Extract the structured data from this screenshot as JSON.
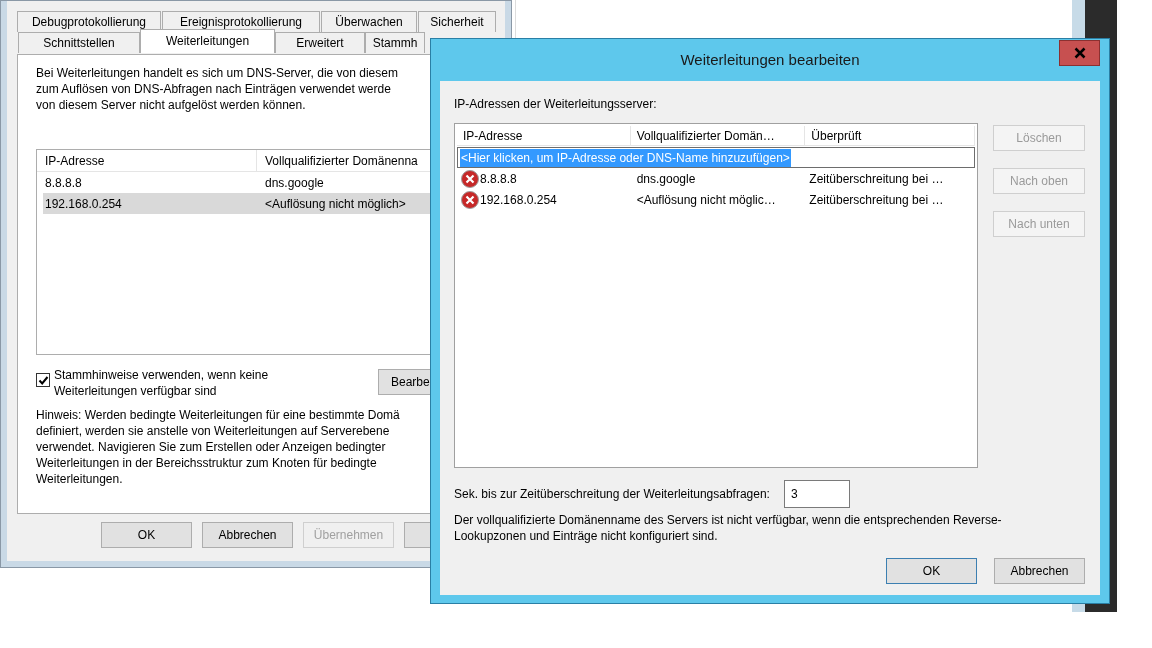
{
  "properties_window": {
    "tabs_row_1": [
      {
        "label": "Debugprotokollierung",
        "selected": false
      },
      {
        "label": "Ereignisprotokollierung",
        "selected": false
      },
      {
        "label": "Überwachen",
        "selected": false
      },
      {
        "label": "Sicherheit",
        "selected": false
      }
    ],
    "tabs_row_2": [
      {
        "label": "Schnittstellen",
        "selected": false
      },
      {
        "label": "Weiterleitungen",
        "selected": true
      },
      {
        "label": "Erweitert",
        "selected": false
      },
      {
        "label": "Stammh",
        "selected": false
      }
    ],
    "description": "Bei Weiterleitungen handelt es sich um DNS-Server, die von diesem\nzum Auflösen von DNS-Abfragen nach Einträgen verwendet werde\nvon diesem Server nicht aufgelöst werden können.",
    "table": {
      "columns": [
        "IP-Adresse",
        "Vollqualifizierter Domänenna"
      ],
      "rows": [
        {
          "cells": [
            "8.8.8.8",
            "dns.google"
          ],
          "selected": false
        },
        {
          "cells": [
            "192.168.0.254",
            "<Auflösung nicht möglich>"
          ],
          "selected": true
        }
      ]
    },
    "root_hints": {
      "label": "Stammhinweise verwenden, wenn keine\nWeiterleitungen verfügbar sind",
      "checked": true
    },
    "edit_button": "Bearbe",
    "note": "Hinweis: Werden bedingte Weiterleitungen für eine bestimmte Domä\ndefiniert, werden sie anstelle von Weiterleitungen auf Serverebene\nverwendet. Navigieren Sie zum Erstellen oder Anzeigen bedingter\nWeiterleitungen in der Bereichsstruktur zum Knoten für bedingte\nWeiterleitungen.",
    "buttons": [
      {
        "label": "OK",
        "disabled": false
      },
      {
        "label": "Abbrechen",
        "disabled": false
      },
      {
        "label": "Übernehmen",
        "disabled": true
      }
    ]
  },
  "dialog": {
    "title": "Weiterleitungen bearbeiten",
    "list_label": "IP-Adressen der Weiterleitungsserver:",
    "columns": [
      "IP-Adresse",
      "Vollqualifizierter Domän…",
      "Überprüft"
    ],
    "add_row": "<Hier klicken, um IP-Adresse oder DNS-Name hinzuzufügen>",
    "rows": [
      {
        "cells": [
          "8.8.8.8",
          "dns.google",
          "Zeitüberschreitung bei …"
        ],
        "kind": "error"
      },
      {
        "cells": [
          "192.168.0.254",
          "<Auflösung nicht möglic…",
          "Zeitüberschreitung bei …"
        ],
        "kind": "error"
      }
    ],
    "side_buttons": [
      {
        "label": "Löschen",
        "disabled": true
      },
      {
        "label": "Nach oben",
        "disabled": true
      },
      {
        "label": "Nach unten",
        "disabled": true
      }
    ],
    "timeout_label": "Sek. bis zur Zeitüberschreitung der Weiterleitungsabfragen:",
    "timeout_value": "3",
    "info": "Der vollqualifizierte Domänenname des Servers ist nicht verfügbar, wenn die entsprechenden Reverse-\nLookupzonen und Einträge nicht konfiguriert sind.",
    "buttons": [
      {
        "label": "OK",
        "default": true
      },
      {
        "label": "Abbrechen",
        "default": false
      }
    ]
  }
}
